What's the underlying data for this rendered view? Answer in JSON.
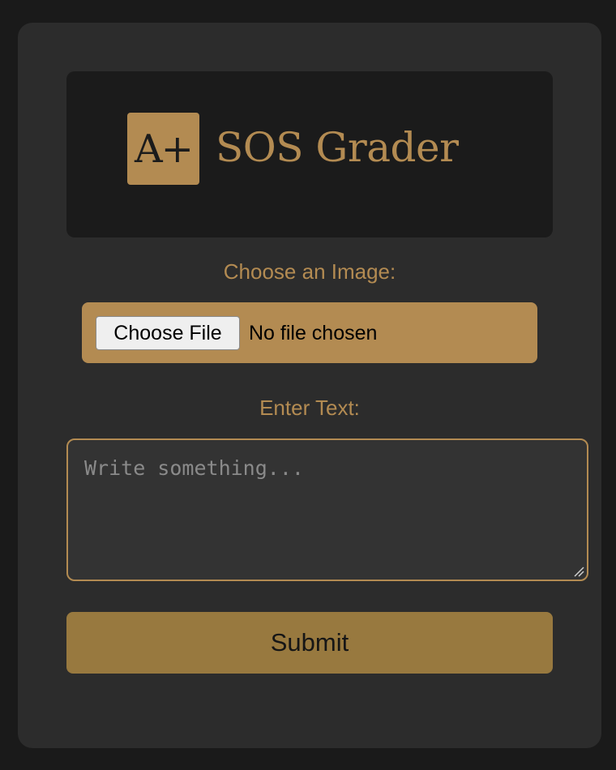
{
  "logo": {
    "badge_text": "A+",
    "brand_name": "SOS Grader"
  },
  "image_section": {
    "label": "Choose an Image:",
    "button_label": "Choose File",
    "status_text": "No file chosen"
  },
  "text_section": {
    "label": "Enter Text:",
    "placeholder": "Write something..."
  },
  "submit": {
    "label": "Submit"
  },
  "colors": {
    "page_background": "#1a1a1a",
    "card_background": "#2c2c2c",
    "accent": "#b38b52",
    "submit_background": "#98793f"
  }
}
